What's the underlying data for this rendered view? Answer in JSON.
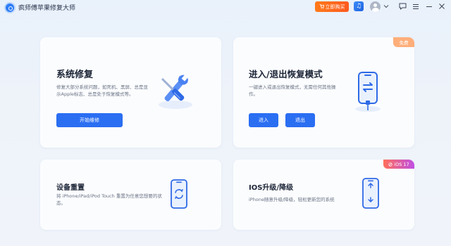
{
  "window": {
    "title": "疯师傅苹果修复大师",
    "buy_button": "立即购买",
    "cart_icon": "cart-icon",
    "music_icon": "music-icon",
    "avatar_icon": "avatar-icon"
  },
  "cards": {
    "system_repair": {
      "title": "系统修复",
      "description": "修复大部分系统问题，如死机、黑屏、总是显示Apple标志、总是处于恢复模式等。",
      "button": "开始维修",
      "icon": "tools-icon"
    },
    "recovery_mode": {
      "title": "进入/退出恢复模式",
      "description": "一键进入或退出恢复模式，无需任何其他操作。",
      "badge": "免费",
      "enter_button": "进入",
      "exit_button": "退出",
      "icon": "phone-cable-icon"
    },
    "factory_reset": {
      "title": "设备重置",
      "description": "将 iPhone/iPad/iPod Touch 重置为任意您想要的状态。",
      "icon": "phone-refresh-icon"
    },
    "ios_upgrade": {
      "title": "IOS升级/降级",
      "description": "iPhone随意升级/降级，轻松更新您的系统",
      "badge": "iOS 17",
      "icon": "phone-updown-icon"
    }
  },
  "colors": {
    "accent": "#2a6ef2",
    "buy": "#ff6a1f",
    "badge_free": "#ffae7a"
  }
}
